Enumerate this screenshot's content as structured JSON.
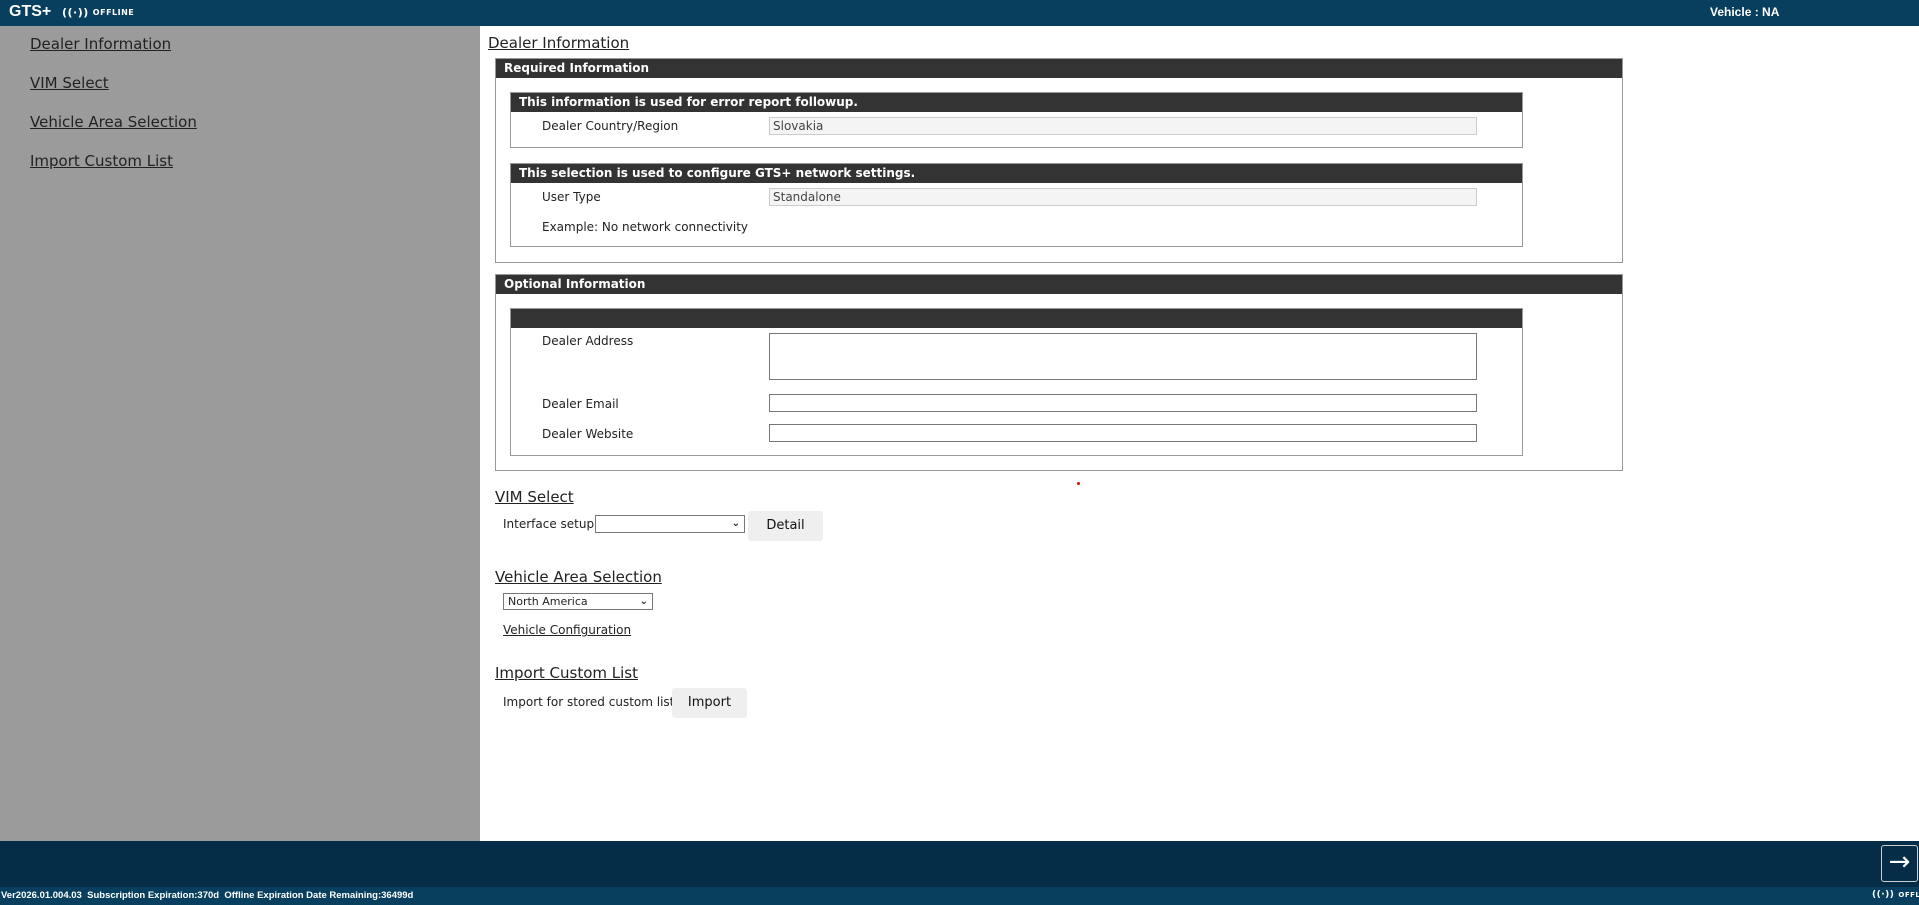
{
  "header": {
    "logo": "GTS+",
    "status": "OFFLINE",
    "vehicle": "Vehicle : NA"
  },
  "sidebar": {
    "items": [
      {
        "label": "Dealer Information"
      },
      {
        "label": "VIM Select"
      },
      {
        "label": "Vehicle Area Selection"
      },
      {
        "label": "Import Custom List"
      }
    ]
  },
  "dealer": {
    "title": "Dealer Information",
    "required": {
      "title": "Required Information",
      "error_box": {
        "title": "This information is used for error report followup.",
        "country_label": "Dealer Country/Region",
        "country_value": "Slovakia"
      },
      "network_box": {
        "title": "This selection is used to configure GTS+ network settings.",
        "user_type_label": "User Type",
        "user_type_value": "Standalone",
        "example": "Example: No network connectivity"
      }
    },
    "optional": {
      "title": "Optional Information",
      "address_label": "Dealer Address",
      "address_value": "",
      "email_label": "Dealer Email",
      "email_value": "",
      "website_label": "Dealer Website",
      "website_value": ""
    }
  },
  "vim": {
    "title": "VIM Select",
    "interface_label": "Interface setup:",
    "interface_value": "",
    "detail_button": "Detail"
  },
  "area": {
    "title": "Vehicle Area Selection",
    "selected": "North America",
    "config_link": "Vehicle Configuration"
  },
  "import": {
    "title": "Import Custom List",
    "label": "Import for stored custom list:",
    "button": "Import"
  },
  "footer": {
    "version": "Ver2026.01.004.03",
    "subscription": "Subscription Expiration:370d",
    "offline_remaining": "Offline Expiration Date Remaining:36499d",
    "status": "OFFLINE"
  },
  "colors": {
    "header": "#083f5e",
    "bottom": "#052d47",
    "sidebar": "#9b9b9b",
    "section_bar": "#333333"
  }
}
